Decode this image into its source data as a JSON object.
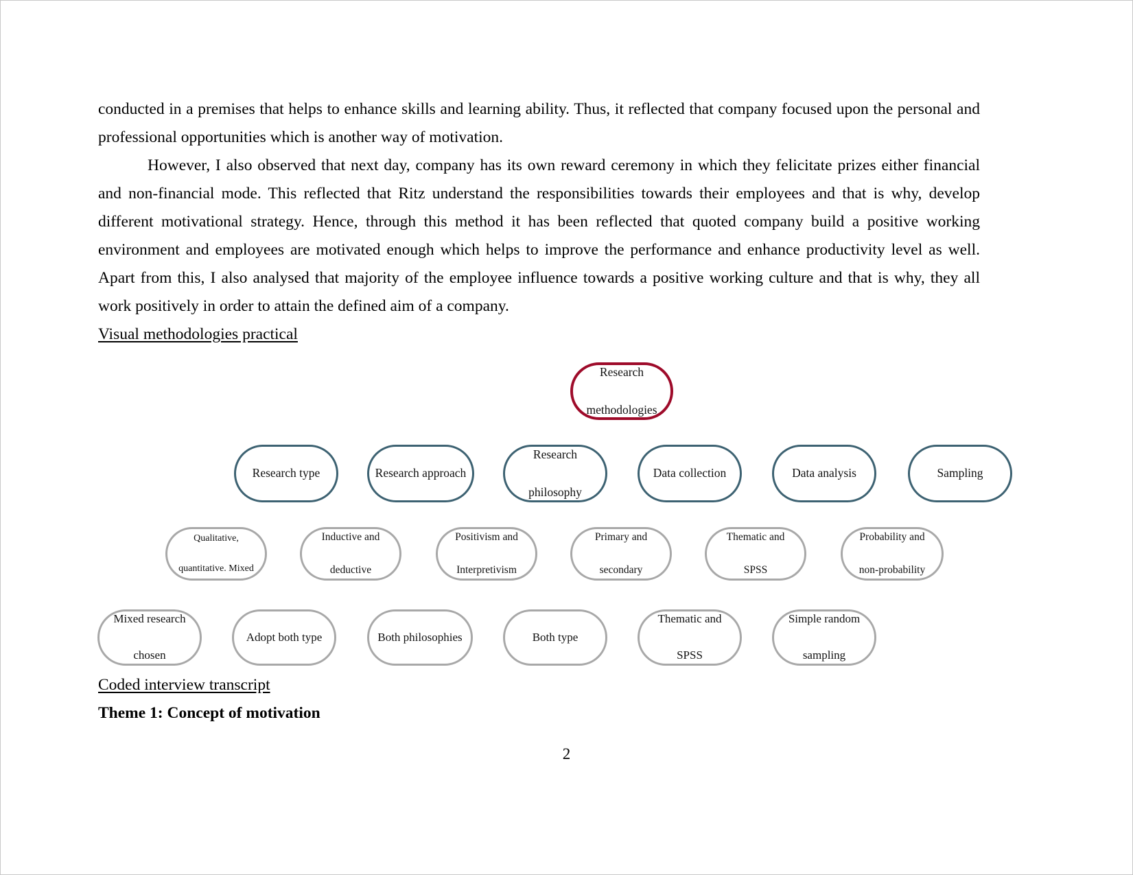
{
  "document": {
    "page_number": "2",
    "paragraphs": [
      {
        "id": "p1",
        "indent": false,
        "text": "conducted in a premises that helps to enhance skills and learning ability. Thus, it reflected that company focused upon the personal and professional opportunities which is another way of motivation."
      },
      {
        "id": "p2",
        "indent": true,
        "text": "However, I also observed that next day, company has its own reward ceremony in which they felicitate prizes either financial and non-financial mode. This reflected that Ritz understand the responsibilities towards their employees and that is why, develop different motivational strategy. Hence, through this method it has been reflected that quoted company build a positive working environment and employees are motivated enough which helps to improve the performance and enhance productivity level as well. Apart from this, I also analysed that majority of the employee influence towards a positive working culture and that is why, they all work positively in order to attain the defined aim of a company."
      }
    ],
    "headings": {
      "visual_methodologies": "Visual methodologies practical",
      "coded_interview": "Coded interview transcript",
      "theme_1": "Theme 1: Concept of motivation"
    }
  },
  "diagram": {
    "colors": {
      "root_border": "#9e0b2a",
      "level2_border": "#3d6272",
      "level3_border": "#a8a8a8",
      "level4_border": "#a8a8a8"
    },
    "root": {
      "label": "Research methodologies",
      "line1": "Research",
      "line2": "methodologies"
    },
    "level2": [
      {
        "label": "Research type",
        "line1": "Research type",
        "line2": ""
      },
      {
        "label": "Research approach",
        "line1": "Research approach",
        "line2": ""
      },
      {
        "label": "Research philosophy",
        "line1": "Research",
        "line2": "philosophy"
      },
      {
        "label": "Data collection",
        "line1": "Data collection",
        "line2": ""
      },
      {
        "label": "Data analysis",
        "line1": "Data analysis",
        "line2": ""
      },
      {
        "label": "Sampling",
        "line1": "Sampling",
        "line2": ""
      }
    ],
    "level3": [
      {
        "label": "Qualitative, quantitative. Mixed",
        "line1": "Qualitative,",
        "line2": "quantitative. Mixed"
      },
      {
        "label": "Inductive and deductive",
        "line1": "Inductive and",
        "line2": "deductive"
      },
      {
        "label": "Positivism and Interpretivism",
        "line1": "Positivism and",
        "line2": "Interpretivism"
      },
      {
        "label": "Primary and secondary",
        "line1": "Primary and",
        "line2": "secondary"
      },
      {
        "label": "Thematic and SPSS",
        "line1": "Thematic and",
        "line2": "SPSS"
      },
      {
        "label": "Probability and non-probability",
        "line1": "Probability and",
        "line2": "non-probability"
      }
    ],
    "level4": [
      {
        "label": "Mixed research chosen",
        "line1": "Mixed research",
        "line2": "chosen"
      },
      {
        "label": "Adopt both type",
        "line1": "Adopt both type",
        "line2": ""
      },
      {
        "label": "Both philosophies",
        "line1": "Both philosophies",
        "line2": ""
      },
      {
        "label": "Both type",
        "line1": "Both type",
        "line2": ""
      },
      {
        "label": "Thematic and SPSS",
        "line1": "Thematic and",
        "line2": "SPSS"
      },
      {
        "label": "Simple random sampling",
        "line1": "Simple random",
        "line2": "sampling"
      }
    ]
  }
}
